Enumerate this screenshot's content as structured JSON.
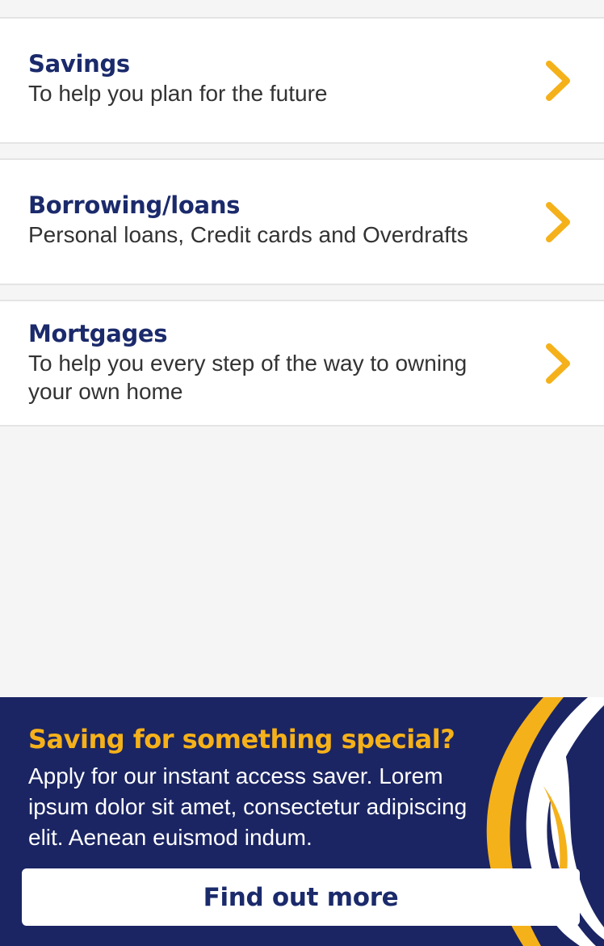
{
  "products": [
    {
      "title": "Savings",
      "subtitle": "To help you plan for the future",
      "chevron_icon": "chevron-right-icon"
    },
    {
      "title": "Borrowing/loans",
      "subtitle": "Personal loans, Credit cards and Overdrafts",
      "chevron_icon": "chevron-right-icon"
    },
    {
      "title": "Mortgages",
      "subtitle": "To help you every step of the way to owning your own home",
      "chevron_icon": "chevron-right-icon"
    }
  ],
  "promo": {
    "title": "Saving for something special?",
    "body": "Apply for our instant access saver. Lorem ipsum dolor sit amet, consectetur adipiscing elit. Aenean euismod indum.",
    "button_label": "Find out more"
  },
  "colors": {
    "brand_navy": "#1b2a6b",
    "promo_background": "#1b2563",
    "accent_yellow": "#f5b11a",
    "page_background": "#f5f5f5",
    "card_background": "#ffffff"
  }
}
